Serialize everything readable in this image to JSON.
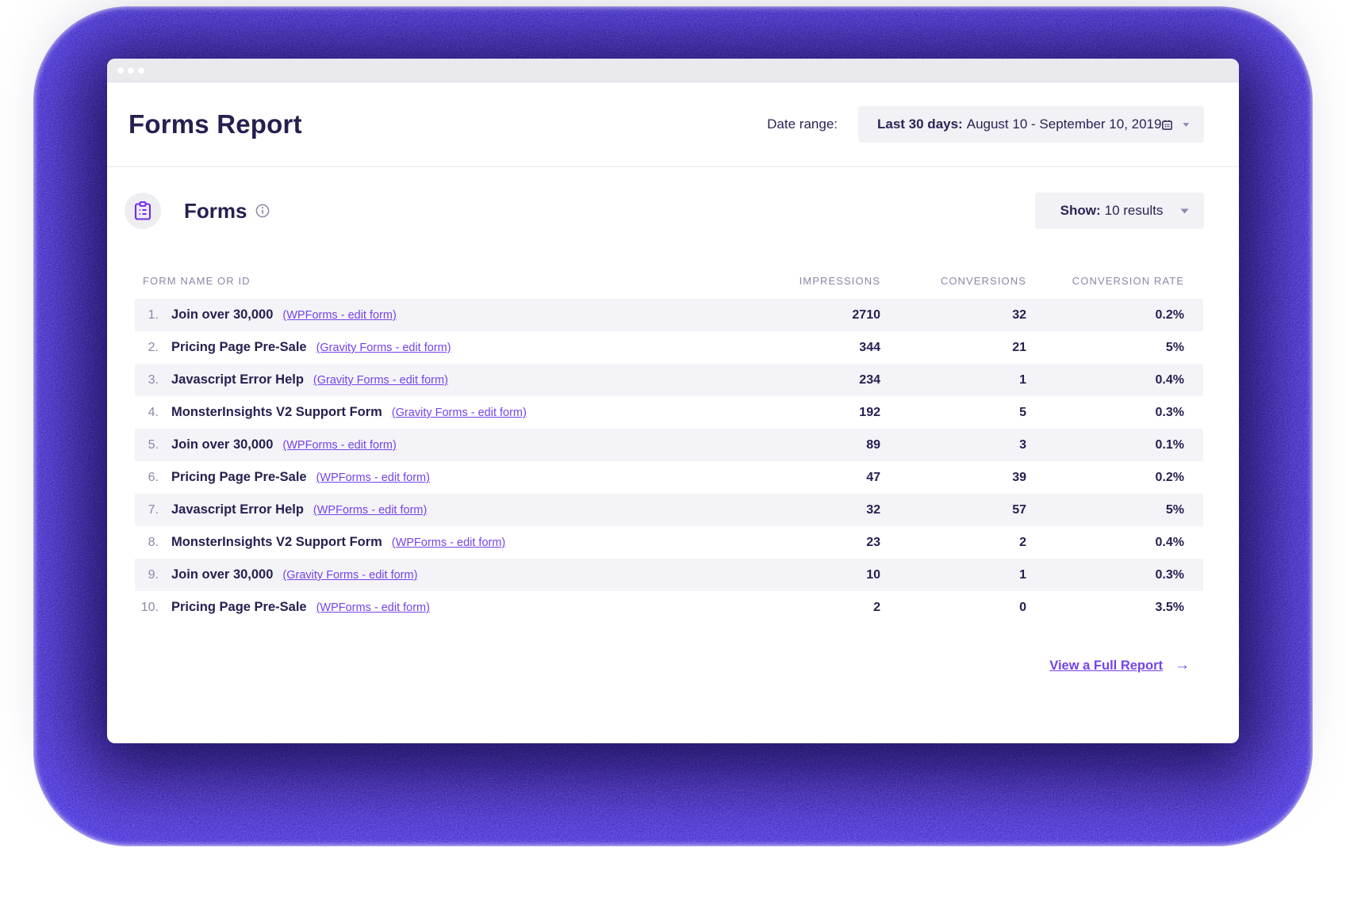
{
  "colors": {
    "accent_purple": "#6F2EE8",
    "link_purple": "#7443EA",
    "navy_text": "#262051",
    "muted_text": "#8B87A8",
    "row_stripe": "#F4F4F8",
    "pill_bg": "#F1F1F6",
    "titlebar_bg": "#E9E9EE",
    "glow_indigo": "#38219E",
    "glow_blue": "#3B2BD8"
  },
  "icons": {
    "calendar": "calendar-icon",
    "chevron_down": "chevron-down-icon",
    "clipboard": "clipboard-icon",
    "info": "info-icon",
    "arrow_right": "arrow-right-icon"
  },
  "header": {
    "title": "Forms Report",
    "date_range_label": "Date range:",
    "date_range_preset": "Last 30 days:",
    "date_range_value": "August 10 - September 10, 2019"
  },
  "forms_section": {
    "title": "Forms",
    "show_label": "Show:",
    "show_value": "10 results"
  },
  "table": {
    "columns": [
      "FORM NAME OR ID",
      "IMPRESSIONS",
      "CONVERSIONS",
      "CONVERSION RATE"
    ],
    "rows": [
      {
        "rank": "1.",
        "name": "Join over 30,000",
        "link": "(WPForms - edit form)",
        "impressions": "2710",
        "conversions": "32",
        "rate": "0.2%"
      },
      {
        "rank": "2.",
        "name": "Pricing Page Pre-Sale",
        "link": "(Gravity Forms - edit form)",
        "impressions": "344",
        "conversions": "21",
        "rate": "5%"
      },
      {
        "rank": "3.",
        "name": "Javascript Error Help",
        "link": "(Gravity Forms - edit form)",
        "impressions": "234",
        "conversions": "1",
        "rate": "0.4%"
      },
      {
        "rank": "4.",
        "name": "MonsterInsights V2 Support Form",
        "link": "(Gravity Forms - edit form)",
        "impressions": "192",
        "conversions": "5",
        "rate": "0.3%"
      },
      {
        "rank": "5.",
        "name": "Join over 30,000",
        "link": "(WPForms - edit form)",
        "impressions": "89",
        "conversions": "3",
        "rate": "0.1%"
      },
      {
        "rank": "6.",
        "name": "Pricing Page Pre-Sale",
        "link": "(WPForms - edit form)",
        "impressions": "47",
        "conversions": "39",
        "rate": "0.2%"
      },
      {
        "rank": "7.",
        "name": "Javascript Error Help",
        "link": "(WPForms - edit form)",
        "impressions": "32",
        "conversions": "57",
        "rate": "5%"
      },
      {
        "rank": "8.",
        "name": "MonsterInsights V2 Support Form",
        "link": "(WPForms - edit form)",
        "impressions": "23",
        "conversions": "2",
        "rate": "0.4%"
      },
      {
        "rank": "9.",
        "name": "Join over 30,000",
        "link": "(Gravity Forms - edit form)",
        "impressions": "10",
        "conversions": "1",
        "rate": "0.3%"
      },
      {
        "rank": "10.",
        "name": "Pricing Page Pre-Sale",
        "link": "(WPForms - edit form)",
        "impressions": "2",
        "conversions": "0",
        "rate": "3.5%"
      }
    ]
  },
  "footer": {
    "link_label": "View a Full Report",
    "arrow": "→"
  }
}
